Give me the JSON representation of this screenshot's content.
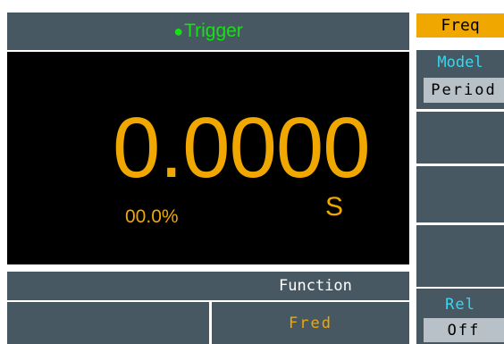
{
  "header": {
    "indicator_icon": "status-dot-icon",
    "title": "Trigger"
  },
  "display": {
    "value": "0.0000",
    "percent": "00.0%",
    "unit": "S"
  },
  "function_bar": {
    "label": "Function"
  },
  "softkeys": [
    {
      "label": ""
    },
    {
      "label": "Fred"
    }
  ],
  "menu": {
    "title": "Freq",
    "model": {
      "label": "Model",
      "value": "Period"
    },
    "rel": {
      "label": "Rel",
      "value": "Off"
    }
  },
  "colors": {
    "panel": "#475862",
    "amber": "#f0a800",
    "green": "#18e018",
    "cyan": "#34d8f0",
    "screen": "#000000",
    "value_box": "#b8c0c8"
  }
}
